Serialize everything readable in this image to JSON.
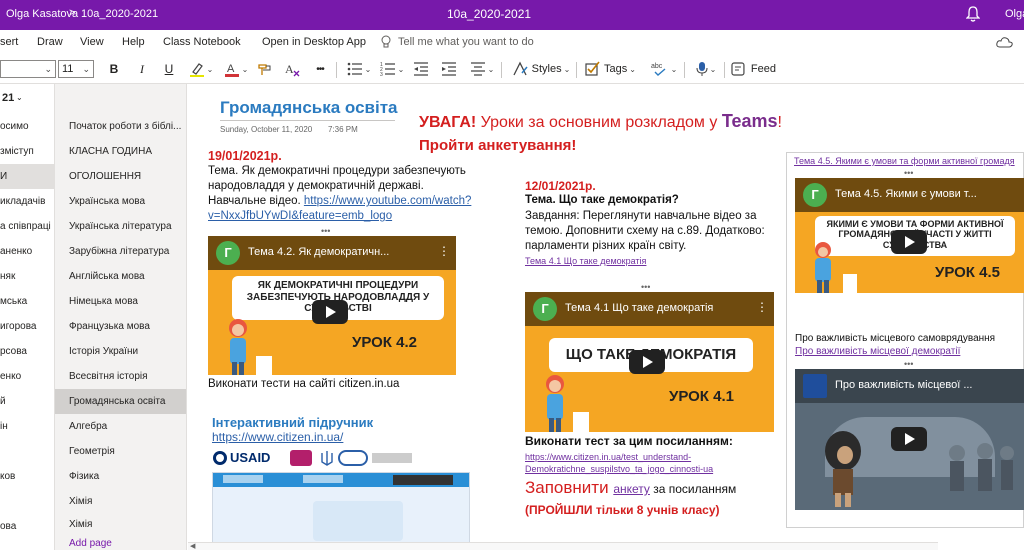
{
  "titlebar": {
    "user": "Olga Kasatova",
    "separator": ">",
    "notebook": "10a_2020-2021",
    "title": "10a_2020-2021",
    "user_short": "Olga"
  },
  "menu": {
    "insert": "sert",
    "draw": "Draw",
    "view": "View",
    "help": "Help",
    "class_notebook": "Class Notebook",
    "open_desktop": "Open in Desktop App",
    "tell_me": "Tell me what you want to do"
  },
  "toolbar": {
    "font_size": "11",
    "styles": "Styles",
    "tags": "Tags",
    "feed": "Feed",
    "bold": "B",
    "italic": "I",
    "underline": "U",
    "more": "•••"
  },
  "sections": {
    "header": "21",
    "items": [
      "осимо",
      "зміступ",
      "И",
      "икладачів",
      "а співпраці",
      "аненко",
      "няк",
      "мська",
      "игорова",
      "рсова",
      "енко",
      "й",
      "ін",
      "ков",
      "ова"
    ]
  },
  "pages": {
    "items": [
      "Початок роботи з біблі...",
      "КЛАСНА ГОДИНА",
      "ОГОЛОШЕННЯ",
      "Українська мова",
      "Українська література",
      "Зарубіжна література",
      "Англійська мова",
      "Німецька мова",
      "Французька мова",
      "Історія України",
      "Всесвітня історія",
      "Громадянська освіта",
      "Алгебра",
      "Геометрія",
      "Фізика",
      "Хімія",
      "Хімія"
    ],
    "add_page": "Add page"
  },
  "page": {
    "title": "Громадянська освіта",
    "date": "Sunday, October 11, 2020",
    "time": "7:36 PM",
    "notice_1": "УВАГА!",
    "notice_2": " Уроки за основним розкладом у ",
    "notice_teams": "Teams",
    "notice_excl": "!",
    "notice_survey": "Пройти анкетування!",
    "left": {
      "date": "19/01/2021р.",
      "line1": "Тема. Як демократичні процедури забезпечують",
      "line2": "народовладдя у демократичній державі.",
      "line3": "Навчальне відео. ",
      "link1": "https://www.youtube.com/watch?",
      "link2": "v=NxxJfbUYwDI&feature=emb_logo",
      "video_title": "Тема 4.2. Як демократичн...",
      "video_band": "ЯК ДЕМОКРАТИЧНІ ПРОЦЕДУРИ ЗАБЕЗПЕЧУЮТЬ НАРОДОВЛАДДЯ У СУСПІЛЬСТВІ",
      "video_lesson": "УРОК 4.2",
      "tests": "Виконати тести  на сайті citizen.in.ua",
      "interactive": "Інтерактивний підручник",
      "citizen_link": "https://www.citizen.in.ua/",
      "usaid": "USAID"
    },
    "middle": {
      "date": "12/01/2021р.",
      "topic": "Тема. Що таке демократія?",
      "task1": "Завдання: Переглянути навчальне відео за",
      "task2": "темою.  Доповнити схему на с.89. Додатково:",
      "task3": "парламенти різних країн світу.",
      "topic_link": "Тема 4.1 Що таке демократія",
      "video_title": "Тема 4.1 Що таке демократія",
      "video_band": "ЩО ТАКЕ ДЕМОКРАТІЯ",
      "video_lesson": "УРОК 4.1",
      "test_heading": "Виконати тест за цим посиланням:",
      "test_link1": "https://www.citizen.in.ua/test_understand-",
      "test_link2": "Demokratichne_suspilstvo_ta_jogo_cinnosti-ua",
      "fill": "Заповнити ",
      "fill_link": "анкету",
      "fill_rest": " за посиланням",
      "passed": "(ПРОЙШЛИ тільки 8 учнів класу)"
    },
    "right": {
      "link_top": "Тема 4.5. Якими є умови та форми активної громадя",
      "video1_title": "Тема 4.5. Якими є умови т...",
      "video1_band": "ЯКИМИ Є УМОВИ ТА ФОРМИ АКТИВНОЇ ГРОМАДЯНСЬКОЇ УЧАСТІ У ЖИТТІ СУСПІЛЬСТВА",
      "video1_lesson": "УРОК 4.5",
      "caption": "Про важливість місцевого самоврядування",
      "caption_link": "Про важливість місцевої демократії",
      "video2_title": "Про важливість місцевої ..."
    }
  }
}
